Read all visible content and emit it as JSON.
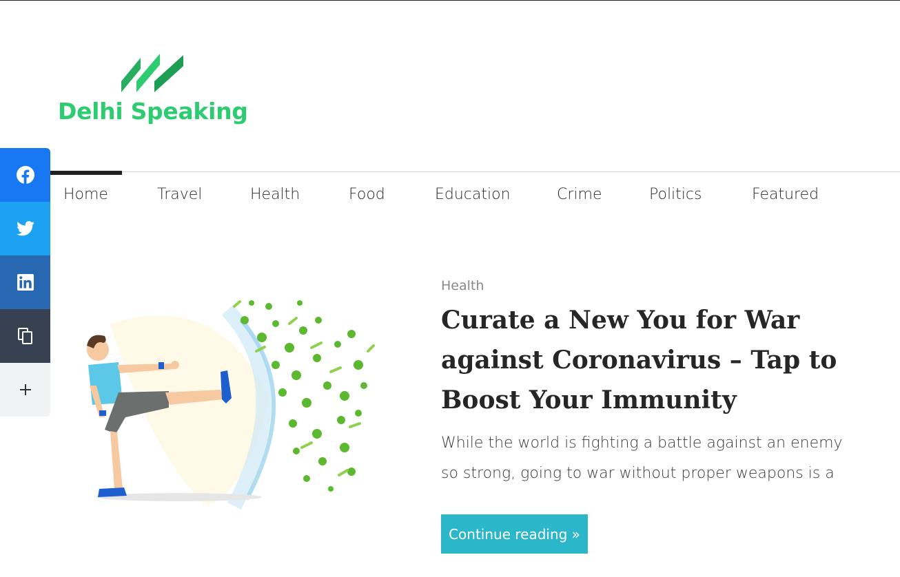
{
  "site": {
    "logo_text": "Delhi Speaking",
    "brand_color": "#2ecc71"
  },
  "nav": {
    "items": [
      {
        "label": "Home"
      },
      {
        "label": "Travel"
      },
      {
        "label": "Health"
      },
      {
        "label": "Food"
      },
      {
        "label": "Education"
      },
      {
        "label": "Crime"
      },
      {
        "label": "Politics"
      },
      {
        "label": "Featured"
      }
    ],
    "active": "Home"
  },
  "share": {
    "buttons": [
      {
        "name": "facebook",
        "icon": "facebook-icon",
        "color": "#1877f2"
      },
      {
        "name": "twitter",
        "icon": "twitter-icon",
        "color": "#1da1f2"
      },
      {
        "name": "linkedin",
        "icon": "linkedin-icon",
        "color": "#2867b2"
      },
      {
        "name": "copy",
        "icon": "copy-icon",
        "color": "#374151"
      },
      {
        "name": "more",
        "icon": "plus-icon",
        "color": "#f1f2f3"
      }
    ]
  },
  "article": {
    "category": "Health",
    "title": "Curate a New You for War against Coronavirus – Tap to Boost Your Immunity",
    "excerpt": "While the world is fighting a battle against an enemy so strong, going to war without proper weapons is a",
    "cta_label": "Continue reading »",
    "cta_color": "#2bb6c9"
  }
}
